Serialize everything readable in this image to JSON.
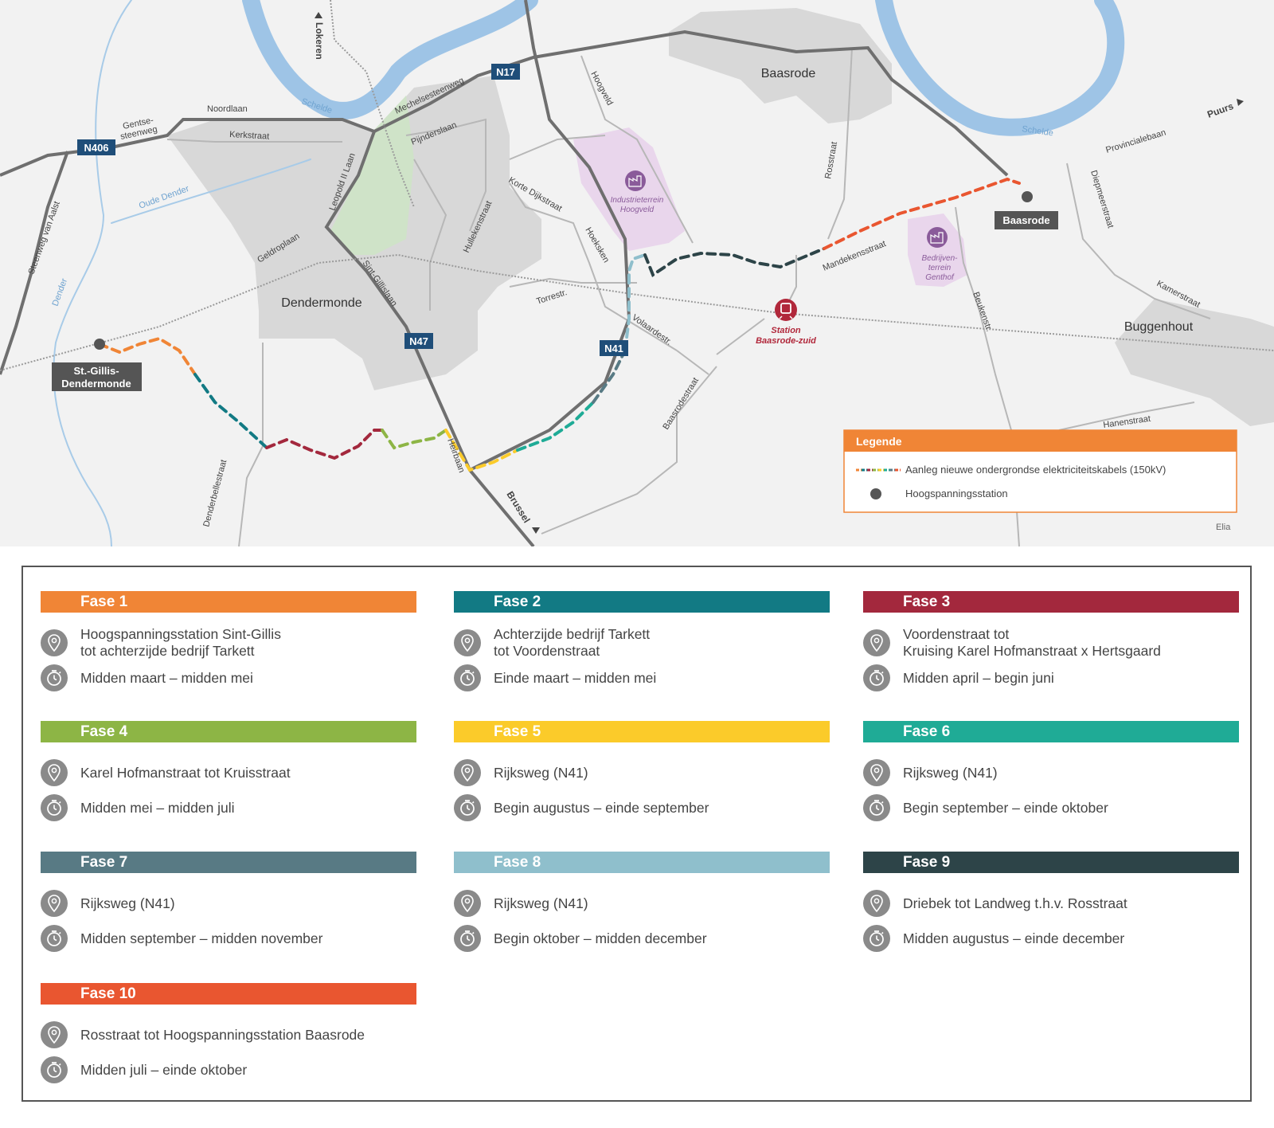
{
  "map": {
    "cities": [
      "Dendermonde",
      "Baasrode",
      "Buggenhout"
    ],
    "roads": [
      "Noordlaan",
      "Gentse-",
      "steenweg",
      "Kerkstraat",
      "Mechelsesteenweg",
      "Pijnderslaan",
      "Leopold II Laan",
      "Geldroplaan",
      "Sint-Gillislaan",
      "Steenweg van Aalst",
      "Hoogveld",
      "Korte Dijkstraat",
      "Hullekenstraat",
      "Hoeksken",
      "Torrestr.",
      "Volaardestr.",
      "Baasrodestraat",
      "Mandekensstraat",
      "Rosstraat",
      "Provincialebaan",
      "Diepmeerstraat",
      "Kamerstraat",
      "Beukenstr.",
      "Hanenstraat",
      "Heirbaan",
      "Denderbellestraat"
    ],
    "water": [
      "Schelde",
      "Schelde",
      "Oude Dender",
      "Dender"
    ],
    "directions": [
      "Lokeren",
      "Puurs",
      "Brussel"
    ],
    "road_badges": [
      "N406",
      "N17",
      "N47",
      "N41"
    ],
    "areas": [
      "Industrieterrein",
      "Hoogveld",
      "Bedrijven-",
      "terrein",
      "Genthof"
    ],
    "stations": {
      "st_gillis_1": "St.-Gillis-",
      "st_gillis_2": "Dendermonde",
      "baasrode": "Baasrode"
    },
    "train_station": {
      "line1": "Station",
      "line2": "Baasrode-zuid"
    },
    "credit": "Elia",
    "legend": {
      "title": "Legende",
      "cable_label": "Aanleg nieuwe ondergrondse elektriciteitskabels (150kV)",
      "station_label": "Hoogspanningsstation"
    }
  },
  "colors": {
    "fase1": "#f08536",
    "fase2": "#127a84",
    "fase3": "#a3283d",
    "fase4": "#8db545",
    "fase5": "#fbcb2a",
    "fase6": "#1fab96",
    "fase7": "#587a84",
    "fase8": "#8fbfcc",
    "fase9": "#2d4448",
    "fase10": "#e95630",
    "legend_header": "#f08536",
    "train": "#b1283b",
    "industrial": "#e9d6ec",
    "water": "#a8cbe8",
    "built": "#d7d7d7"
  },
  "phases": [
    {
      "title": "Fase 1",
      "location": "Hoogspanningsstation Sint-Gillis\ntot achterzijde bedrijf Tarkett",
      "period": "Midden maart – midden mei"
    },
    {
      "title": "Fase 2",
      "location": "Achterzijde bedrijf Tarkett\ntot Voordenstraat",
      "period": "Einde maart – midden mei"
    },
    {
      "title": "Fase 3",
      "location": "Voordenstraat tot\nKruising Karel Hofmanstraat x Hertsgaard",
      "period": "Midden april – begin juni"
    },
    {
      "title": "Fase 4",
      "location": "Karel Hofmanstraat tot Kruisstraat",
      "period": "Midden mei – midden juli"
    },
    {
      "title": "Fase 5",
      "location": "Rijksweg (N41)",
      "period": "Begin augustus – einde september"
    },
    {
      "title": "Fase 6",
      "location": "Rijksweg (N41)",
      "period": "Begin september – einde oktober"
    },
    {
      "title": "Fase 7",
      "location": "Rijksweg (N41)",
      "period": "Midden september – midden november"
    },
    {
      "title": "Fase 8",
      "location": "Rijksweg (N41)",
      "period": "Begin oktober – midden december"
    },
    {
      "title": "Fase 9",
      "location": "Driebek tot Landweg t.h.v. Rosstraat",
      "period": "Midden augustus – einde december"
    },
    {
      "title": "Fase 10",
      "location": "Rosstraat tot Hoogspanningsstation Baasrode",
      "period": "Midden juli – einde oktober"
    }
  ]
}
